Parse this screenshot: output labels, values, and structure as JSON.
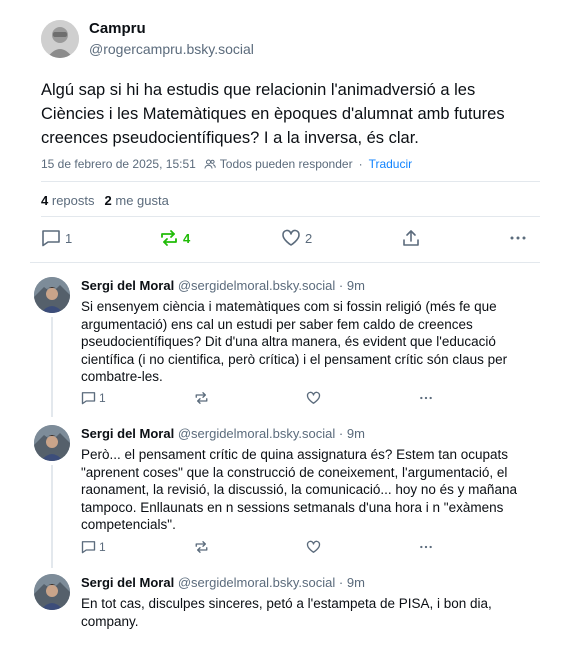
{
  "post": {
    "author_name": "Campru",
    "author_handle": "@rogercampru.bsky.social",
    "text": "Algú sap si hi ha estudis que relacionin l'animadversió a les Ciències i les Matemàtiques en èpoques d'alumnat amb futures creences pseudocientífiques? I a la inversa, és clar.",
    "timestamp": "15 de febrero de 2025, 15:51",
    "reply_permission": "Todos pueden responder",
    "translate_label": "Traducir",
    "reposts_count": "4",
    "reposts_label": "reposts",
    "likes_count": "2",
    "likes_label": "me gusta",
    "actions": {
      "replies": "1",
      "reposts": "4",
      "likes": "2"
    }
  },
  "replies": [
    {
      "name": "Sergi del Moral",
      "handle": "@sergidelmoral.bsky.social",
      "time": "9m",
      "text": "Si ensenyem ciència i matemàtiques com si fossin religió (més fe que argumentació) ens cal un estudi per saber fem caldo de creences pseudocientífiques? Dit d'una altra manera, és evident que l'educació científica (i no cientifica, però crítica) i el pensament crític són claus per combatre-les.",
      "reply_count": "1"
    },
    {
      "name": "Sergi del Moral",
      "handle": "@sergidelmoral.bsky.social",
      "time": "9m",
      "text": "Però... el pensament crític de quina assignatura és? Estem tan ocupats \"aprenent coses\" que la construcció de coneixement, l'argumentació, el raonament, la revisió, la discussió, la comunicació... hoy no és y mañana tampoco. Enllaunats en n sessions setmanals d'una hora i n \"exàmens competencials\".",
      "reply_count": "1"
    },
    {
      "name": "Sergi del Moral",
      "handle": "@sergidelmoral.bsky.social",
      "time": "9m",
      "text": "En tot cas, disculpes sinceres, petó a l'estampeta de PISA, i bon dia, company."
    }
  ],
  "separators": {
    "dot": "·"
  },
  "icons": {
    "reply": "reply-icon",
    "repost": "repost-icon",
    "like": "heart-icon",
    "share": "share-icon",
    "more": "more-icon",
    "people": "people-icon"
  },
  "colors": {
    "accent": "#1083fe",
    "repost_active": "#20bc07",
    "muted": "#5b6b7c"
  }
}
